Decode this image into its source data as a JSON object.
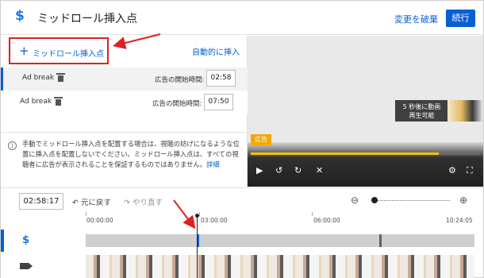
{
  "header": {
    "icon": "dollar-icon",
    "title": "ミッドロール挿入点",
    "discard_label": "変更を破棄",
    "continue_label": "続行",
    "accent_color": "#065fd4"
  },
  "left_panel": {
    "add_label": "ミッドロール挿入点",
    "auto_insert_label": "自動的に挿入",
    "breaks": [
      {
        "label": "Ad break",
        "start_label": "広告の開始時間:",
        "time": "02:58",
        "selected": true
      },
      {
        "label": "Ad break",
        "start_label": "広告の開始時間:",
        "time": "07:50",
        "selected": false
      }
    ],
    "notice": "手動でミッドロール挿入点を配置する場合は、視聴の妨げになるような位置に挿入点を配置しないでください。ミッドロール挿入点は、すべての視聴者に広告が表示されることを保証するものではありません。",
    "notice_link": "詳細"
  },
  "video": {
    "skip_line1": "5 秒後に動画",
    "skip_line2": "再生可能",
    "ad_badge": "広告",
    "progress": 0.82
  },
  "timeline": {
    "current_time": "02:58:17",
    "undo_label": "元に戻す",
    "redo_label": "やり直す",
    "ticks": [
      "00:00:00",
      "03:00:00",
      "06:00:00",
      "10:24:05"
    ]
  }
}
